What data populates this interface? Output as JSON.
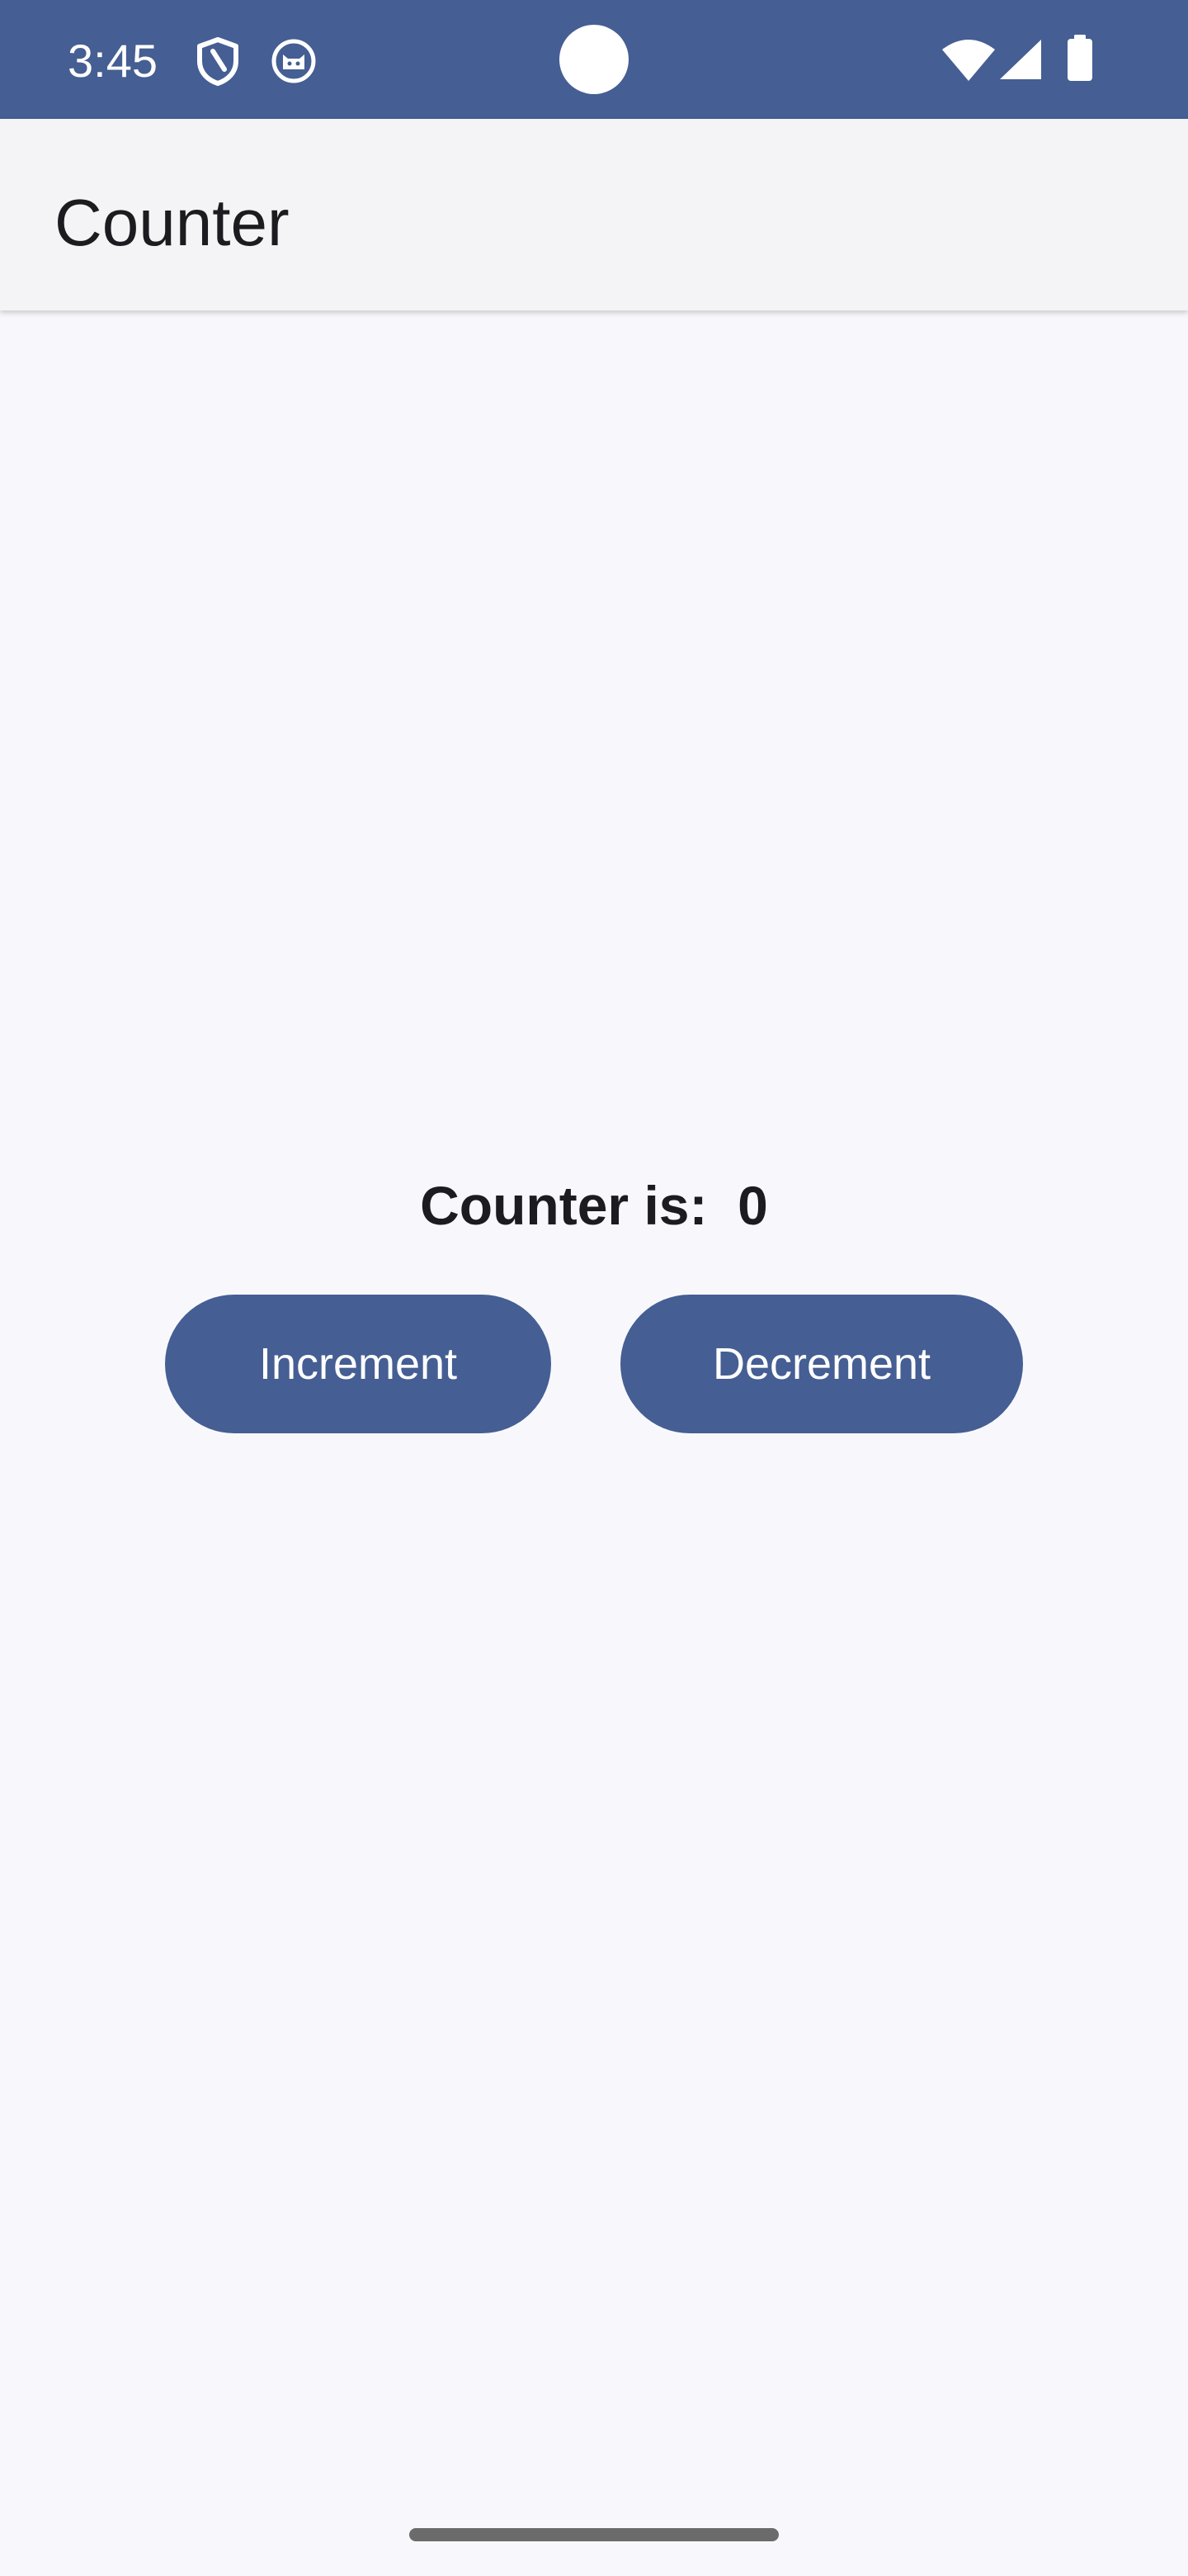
{
  "status_bar": {
    "time": "3:45",
    "icons": [
      "shield-icon",
      "cat-face-icon",
      "wifi-icon",
      "cellular-signal-icon",
      "battery-icon"
    ],
    "background": "#455e93"
  },
  "app_bar": {
    "title": "Counter"
  },
  "main": {
    "counter_label": "Counter is:  0",
    "increment_label": "Increment",
    "decrement_label": "Decrement"
  },
  "colors": {
    "primary": "#455e93",
    "background": "#f8f8fc",
    "app_bar": "#f4f4f6"
  }
}
